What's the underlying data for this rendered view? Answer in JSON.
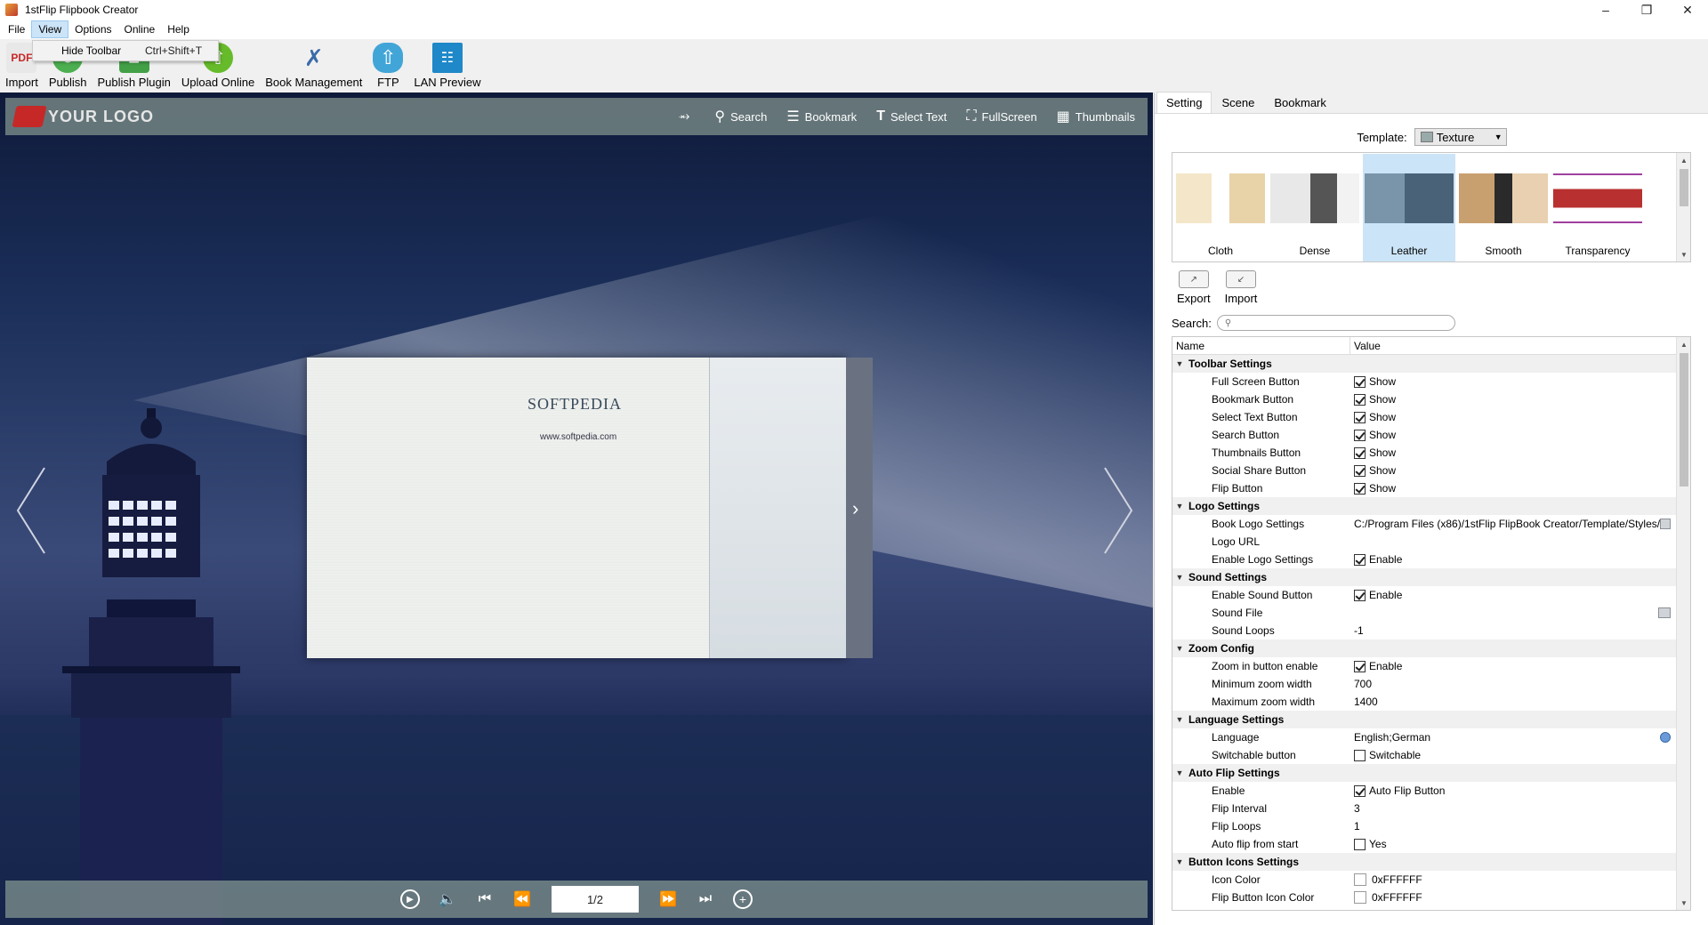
{
  "window": {
    "title": "1stFlip Flipbook Creator"
  },
  "menu": {
    "items": [
      "File",
      "View",
      "Options",
      "Online",
      "Help"
    ]
  },
  "view_menu": {
    "item_label": "Hide Toolbar",
    "item_shortcut": "Ctrl+Shift+T"
  },
  "toolbar": {
    "buttons": [
      "Import",
      "Publish",
      "Publish Plugin",
      "Upload Online",
      "Book Management",
      "FTP",
      "LAN Preview"
    ]
  },
  "viewer": {
    "logo_text": "YOUR LOGO",
    "tools": [
      "Search",
      "Bookmark",
      "Select Text",
      "FullScreen",
      "Thumbnails"
    ],
    "page_indicator": "1/2",
    "book_brand": "SOFTPEDIA",
    "book_url": "www.softpedia.com"
  },
  "panel": {
    "tabs": [
      "Setting",
      "Scene",
      "Bookmark"
    ],
    "template_label": "Template:",
    "template_value": "Texture",
    "templates": [
      "Cloth",
      "Dense",
      "Leather",
      "Smooth",
      "Transparency"
    ],
    "export_label": "Export",
    "import_label": "Import",
    "search_label": "Search:",
    "grid_headers": {
      "name": "Name",
      "value": "Value"
    },
    "groups": [
      {
        "title": "Toolbar Settings",
        "rows": [
          {
            "name": "Full Screen Button",
            "type": "check",
            "checked": true,
            "value": "Show"
          },
          {
            "name": "Bookmark Button",
            "type": "check",
            "checked": true,
            "value": "Show"
          },
          {
            "name": "Select Text Button",
            "type": "check",
            "checked": true,
            "value": "Show"
          },
          {
            "name": "Search Button",
            "type": "check",
            "checked": true,
            "value": "Show"
          },
          {
            "name": "Thumbnails Button",
            "type": "check",
            "checked": true,
            "value": "Show"
          },
          {
            "name": "Social Share Button",
            "type": "check",
            "checked": true,
            "value": "Show"
          },
          {
            "name": "Flip Button",
            "type": "check",
            "checked": true,
            "value": "Show"
          }
        ]
      },
      {
        "title": "Logo Settings",
        "rows": [
          {
            "name": "Book Logo Settings",
            "type": "text",
            "value": "C:/Program Files (x86)/1stFlip FlipBook Creator/Template/Styles/",
            "tail": "folder"
          },
          {
            "name": "Logo URL",
            "type": "text",
            "value": ""
          },
          {
            "name": "Enable Logo Settings",
            "type": "check",
            "checked": true,
            "value": "Enable"
          }
        ]
      },
      {
        "title": "Sound Settings",
        "rows": [
          {
            "name": "Enable Sound Button",
            "type": "check",
            "checked": true,
            "value": "Enable"
          },
          {
            "name": "Sound File",
            "type": "text",
            "value": "",
            "tail": "folder"
          },
          {
            "name": "Sound Loops",
            "type": "text",
            "value": "-1"
          }
        ]
      },
      {
        "title": "Zoom Config",
        "rows": [
          {
            "name": "Zoom in button enable",
            "type": "check",
            "checked": true,
            "value": "Enable"
          },
          {
            "name": "Minimum zoom width",
            "type": "text",
            "value": "700"
          },
          {
            "name": "Maximum zoom width",
            "type": "text",
            "value": "1400"
          }
        ]
      },
      {
        "title": "Language Settings",
        "rows": [
          {
            "name": "Language",
            "type": "text",
            "value": "English;German",
            "tail": "globe"
          },
          {
            "name": "Switchable button",
            "type": "check",
            "checked": false,
            "value": "Switchable"
          }
        ]
      },
      {
        "title": "Auto Flip Settings",
        "rows": [
          {
            "name": "Enable",
            "type": "check",
            "checked": true,
            "value": "Auto Flip Button"
          },
          {
            "name": "Flip Interval",
            "type": "text",
            "value": "3"
          },
          {
            "name": "Flip Loops",
            "type": "text",
            "value": "1"
          },
          {
            "name": "Auto flip from start",
            "type": "check",
            "checked": false,
            "value": "Yes"
          }
        ]
      },
      {
        "title": "Button Icons Settings",
        "rows": [
          {
            "name": "Icon Color",
            "type": "color",
            "value": "0xFFFFFF"
          },
          {
            "name": "Flip Button Icon Color",
            "type": "color",
            "value": "0xFFFFFF"
          }
        ]
      }
    ]
  },
  "colors": {
    "selection": "#cce4f7",
    "viewer_bar": "#a9bea9"
  }
}
